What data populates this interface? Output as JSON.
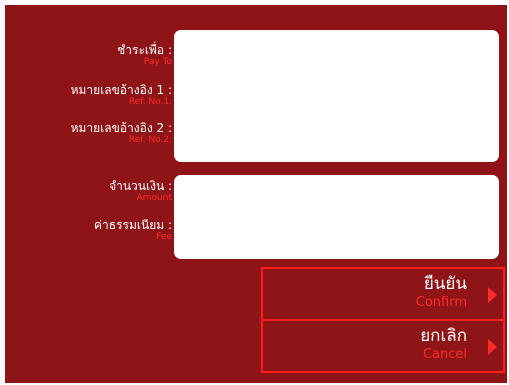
{
  "form": {
    "pay_to": {
      "th": "ชำระเพื่อ :",
      "en": "Pay To"
    },
    "ref1": {
      "th": "หมายเลขอ้างอิง 1 :",
      "en": "Ref. No.1."
    },
    "ref2": {
      "th": "หมายเลขอ้างอิง 2 :",
      "en": "Ref. No.2."
    },
    "amount": {
      "th": "จำนวนเงิน :",
      "en": "Amount"
    },
    "fee": {
      "th": "ค่าธรรมเนียม :",
      "en": "Fee"
    }
  },
  "actions": {
    "confirm": {
      "th": "ยืนยัน",
      "en": "Confirm"
    },
    "cancel": {
      "th": "ยกเลิก",
      "en": "Cancel"
    }
  },
  "colors": {
    "background": "#8e1418",
    "accent": "#ff2a2a",
    "panel": "#ffffff"
  },
  "icons": {
    "confirm_arrow": "triangle-right-icon",
    "cancel_arrow": "triangle-right-icon"
  }
}
